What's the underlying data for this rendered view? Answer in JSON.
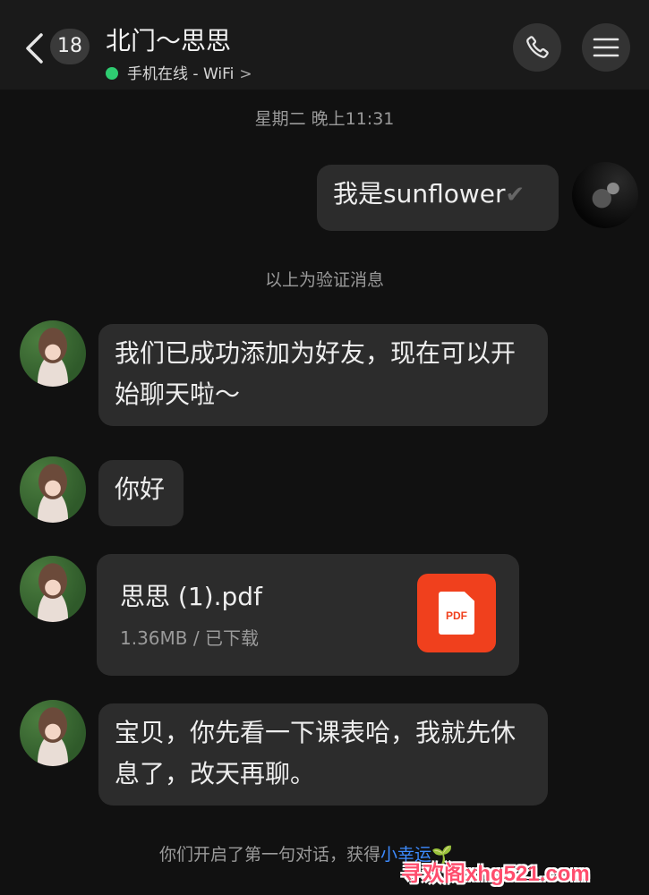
{
  "header": {
    "unread_count": "18",
    "title": "北门～思思",
    "status": "手机在线 - WiFi",
    "status_chevron": ">",
    "status_color": "#2ecc71"
  },
  "timestamp": "星期二 晚上11:31",
  "messages": {
    "outgoing_1": "我是sunflower",
    "system_verify": "以上为验证消息",
    "incoming_1": "我们已成功添加为好友，现在可以开始聊天啦～",
    "incoming_2": "你好",
    "file": {
      "name": "思思 (1).pdf",
      "meta": "1.36MB / 已下载",
      "icon_label": "PDF"
    },
    "incoming_3": "宝贝，你先看一下课表哈，我就先休息了，改天再聊。"
  },
  "footer": {
    "note": "你们开启了第一句对话，获得",
    "link": "小幸运",
    "link_color": "#3d8bff"
  },
  "watermark": "寻欢阁xhg521.com"
}
